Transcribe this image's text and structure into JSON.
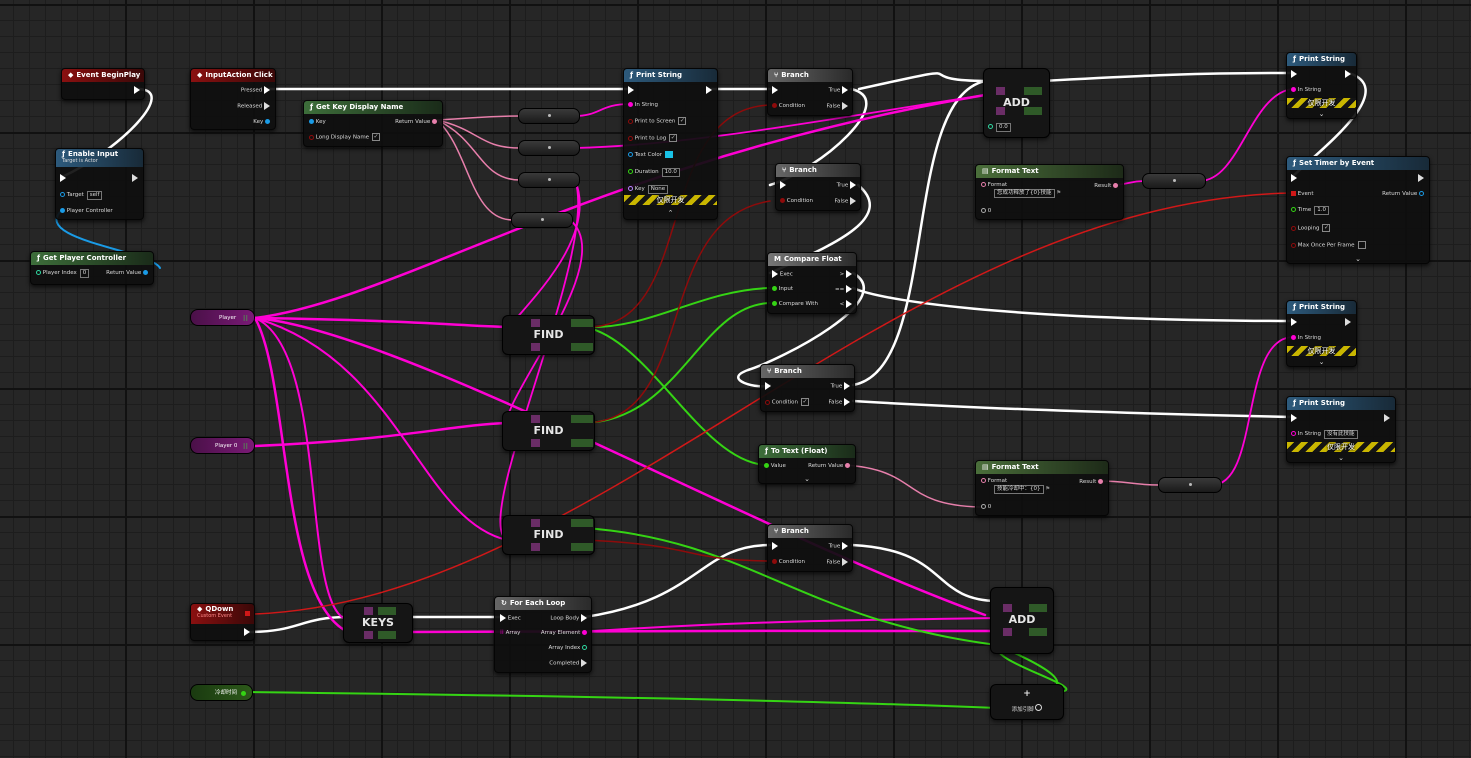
{
  "nodes": {
    "event_begin_play": {
      "title": "Event BeginPlay"
    },
    "enable_input": {
      "title": "Enable Input",
      "subtitle": "Target is Actor",
      "target_label": "Target",
      "target_value": "self",
      "pc_label": "Player Controller"
    },
    "get_player_controller": {
      "title": "Get Player Controller",
      "index_label": "Player Index",
      "index_value": "0",
      "return_label": "Return Value"
    },
    "input_action": {
      "title": "InputAction Click",
      "pressed": "Pressed",
      "released": "Released",
      "key": "Key"
    },
    "get_key_display_name": {
      "title": "Get Key Display Name",
      "key": "Key",
      "return": "Return Value",
      "long": "Long Display Name"
    },
    "print_string_1": {
      "title": "Print String",
      "in_string": "In String",
      "print_to_screen": "Print to Screen",
      "print_to_log": "Print to Log",
      "text_color": "Text Color",
      "duration": "Duration",
      "duration_value": "10.0",
      "key": "Key",
      "key_value": "None",
      "dev_only": "仅限开发"
    },
    "branch_1": {
      "title": "Branch",
      "true": "True",
      "false": "False",
      "condition": "Condition"
    },
    "branch_2": {
      "title": "Branch",
      "true": "True",
      "false": "False",
      "condition": "Condition"
    },
    "compare_float": {
      "title": "Compare Float",
      "exec": "Exec",
      "input": "Input",
      "compare_with": "Compare With",
      "gt": ">",
      "eq": "==",
      "lt": "<"
    },
    "branch_3": {
      "title": "Branch",
      "true": "True",
      "false": "False",
      "condition": "Condition"
    },
    "to_text_float": {
      "title": "To Text (Float)",
      "value": "Value",
      "return": "Return Value"
    },
    "branch_4": {
      "title": "Branch",
      "true": "True",
      "false": "False",
      "condition": "Condition"
    },
    "for_each_loop": {
      "title": "For Each Loop",
      "exec": "Exec",
      "loop_body": "Loop Body",
      "array": "Array",
      "array_element": "Array Element",
      "array_index": "Array Index",
      "completed": "Completed"
    },
    "qdown": {
      "title": "QDown",
      "subtitle": "Custom Event"
    },
    "add_1": {
      "label": "ADD",
      "value": "0.0"
    },
    "add_2": {
      "label": "ADD"
    },
    "add_pin": {
      "label": "添加引脚"
    },
    "format_text_1": {
      "title": "Format Text",
      "format_label": "Format",
      "format_value": "您成功释放了{0}技能",
      "result": "Result",
      "zero": "0"
    },
    "format_text_2": {
      "title": "Format Text",
      "format_label": "Format",
      "format_value": "技能冷却中：{0}",
      "result": "Result",
      "zero": "0"
    },
    "print_string_2": {
      "title": "Print String",
      "in_string": "In String",
      "dev_only": "仅限开发"
    },
    "set_timer": {
      "title": "Set Timer by Event",
      "event": "Event",
      "return": "Return Value",
      "time": "Time",
      "time_value": "1.0",
      "looping": "Looping",
      "max_once": "Max Once Per Frame"
    },
    "print_string_3": {
      "title": "Print String",
      "in_string": "In String",
      "dev_only": "仅限开发"
    },
    "print_string_4": {
      "title": "Print String",
      "in_string": "In String",
      "in_string_value": "没有此技能",
      "dev_only": "仅限开发"
    },
    "find_1": {
      "label": "FIND"
    },
    "find_2": {
      "label": "FIND"
    },
    "find_3": {
      "label": "FIND"
    },
    "keys": {
      "label": "KEYS"
    }
  },
  "variables": {
    "player": "Player",
    "player0": "Player 0",
    "cooldown": "冷却时间"
  },
  "colors": {
    "exec": "#ffffff",
    "string": "#ff00d4",
    "text": "#e77fab",
    "float": "#35d414",
    "bool": "#8e0b0b",
    "object": "#049bf0",
    "event": "#d01818"
  }
}
